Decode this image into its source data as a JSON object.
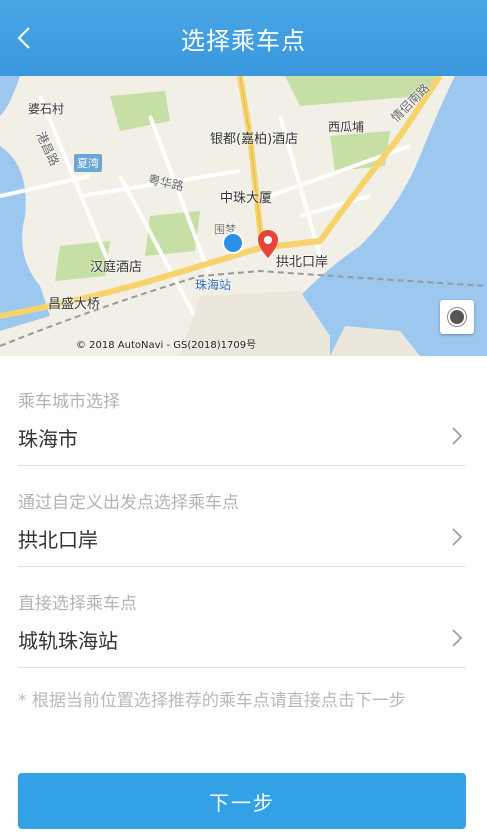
{
  "header": {
    "title": "选择乘车点",
    "back_icon": "chevron-left-icon"
  },
  "map": {
    "labels": {
      "lingshicun": "婆石村",
      "yinduhotel": "银都(嘉柏)酒店",
      "xiguapu": "西瓜埔",
      "qinglvroad": "情侣南路",
      "xiawan": "夏湾",
      "yuehuaroad": "粤华路",
      "zhongzhu": "中珠大厦",
      "gangchang": "港昌路",
      "weimeng": "围梦",
      "hanting": "汉庭酒店",
      "gongbei": "拱北口岸",
      "zhuhaistation": "珠海站",
      "changsheng": "昌盛大桥"
    },
    "copyright": "© 2018 AutoNavi - GS(2018)1709号",
    "colors": {
      "water": "#9cc8f0",
      "road": "#f7d36b",
      "park": "#c5dfa5",
      "land": "#f2efe6"
    }
  },
  "form": {
    "city": {
      "label": "乘车城市选择",
      "value": "珠海市"
    },
    "custom": {
      "label": "通过自定义出发点选择乘车点",
      "value": "拱北口岸"
    },
    "direct": {
      "label": "直接选择乘车点",
      "value": "城轨珠海站"
    }
  },
  "hint": "* 根据当前位置选择推荐的乘车点请直接点击下一步",
  "next_button": "下一步",
  "colors": {
    "primary": "#33a1e6",
    "header": "#3a97dc"
  }
}
